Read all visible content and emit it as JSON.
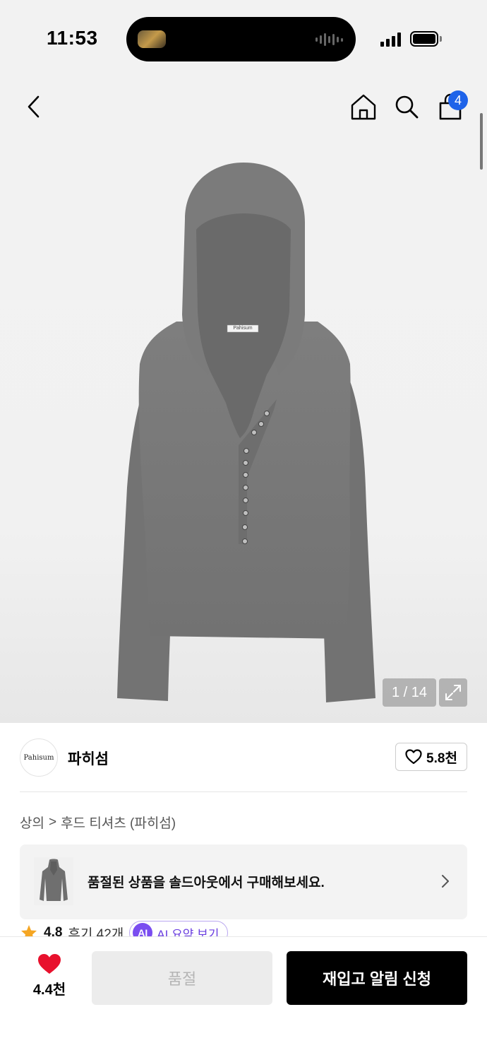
{
  "status_bar": {
    "time": "11:53"
  },
  "header": {
    "cart_count": "4"
  },
  "gallery": {
    "counter": "1 / 14",
    "label_tag": "Pahisum"
  },
  "brand": {
    "logo_text": "Pahisum",
    "name": "파히섬",
    "likes": "5.8천"
  },
  "breadcrumb": {
    "category": "상의",
    "separator": ">",
    "subcategory": "후드 티셔츠 (파히섬)"
  },
  "soldout_banner": {
    "text": "품절된 상품을 솔드아웃에서 구매해보세요."
  },
  "rating": {
    "score": "4.8",
    "reviews": "후기 42개",
    "ai_badge": "AI",
    "ai_label": "AI 요약 보기"
  },
  "bottom_bar": {
    "wish_count": "4.4천",
    "soldout_label": "품절",
    "restock_label": "재입고 알림 신청"
  },
  "colors": {
    "accent_blue": "#1e63e9",
    "heart_red": "#e8112d",
    "ai_purple": "#7a4df0",
    "star_orange": "#f5a623"
  }
}
